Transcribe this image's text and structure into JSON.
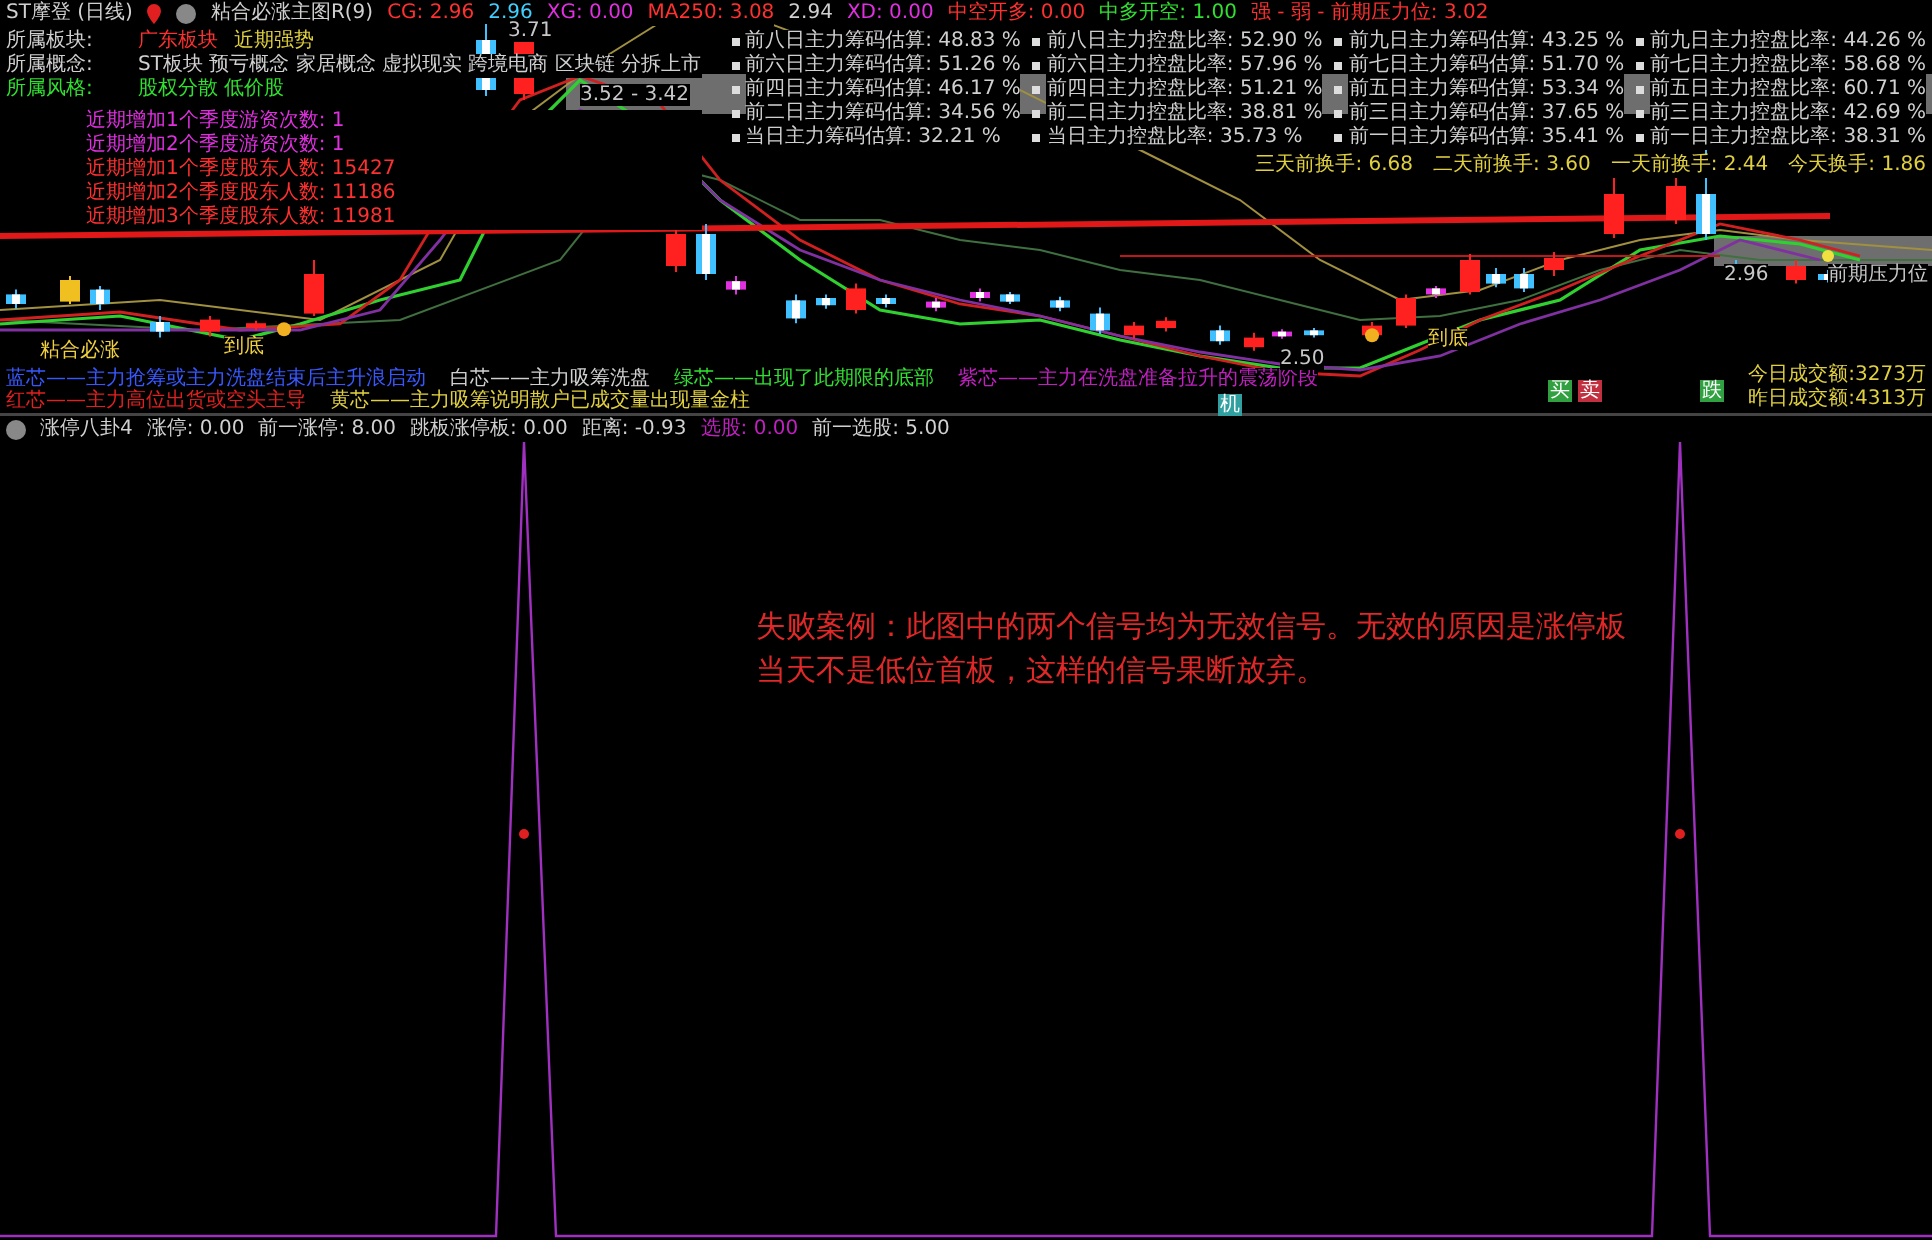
{
  "header": {
    "title": "ST摩登 (日线)",
    "indicator": "粘合必涨主图R(9)",
    "values": [
      {
        "text": "CG: 2.96",
        "color": "#ff3030"
      },
      {
        "text": "2.96",
        "color": "#40d0ff"
      },
      {
        "text": "XG: 0.00",
        "color": "#e030e0"
      },
      {
        "text": "MA250: 3.08",
        "color": "#ff3030"
      },
      {
        "text": "2.94",
        "color": "#d0d0d0"
      },
      {
        "text": "XD: 0.00",
        "color": "#e030e0"
      },
      {
        "text": "中空开多: 0.00",
        "color": "#ff3030"
      },
      {
        "text": "中多开空: 1.00",
        "color": "#30e030"
      },
      {
        "text": "强 - 弱 - 前期压力位: 3.02",
        "color": "#ff3030"
      }
    ]
  },
  "info_rows": [
    {
      "values": [
        {
          "text": "所属板块:",
          "color": "#d0d0d0"
        },
        {
          "text": "广东板块",
          "color": "#ff3030"
        },
        {
          "text": "近期强势",
          "color": "#e0d040"
        }
      ]
    },
    {
      "values": [
        {
          "text": "所属概念:",
          "color": "#d0d0d0"
        },
        {
          "text": "ST板块 预亏概念 家居概念 虚拟现实 跨境电商 区块链 分拆上市",
          "color": "#d0d0d0"
        }
      ]
    },
    {
      "values": [
        {
          "text": "所属风格:",
          "color": "#30e030"
        },
        {
          "text": "股权分散 低价股",
          "color": "#30e030"
        }
      ]
    }
  ],
  "holder_stats": [
    {
      "text": "近期增加1个季度游资次数: 1",
      "color": "#e030e0"
    },
    {
      "text": "近期增加2个季度游资次数: 1",
      "color": "#e030e0"
    },
    {
      "text": "近期增加1个季度股东人数: 15427",
      "color": "#ff3030"
    },
    {
      "text": "近期增加2个季度股东人数: 11186",
      "color": "#ff3030"
    },
    {
      "text": "近期增加3个季度股东人数: 11981",
      "color": "#ff3030"
    }
  ],
  "main_force_stats": [
    [
      "前八日主力筹码估算: 48.83 %",
      "前六日主力筹码估算: 51.26 %",
      "前四日主力筹码估算: 46.17 %",
      "前二日主力筹码估算: 34.56 %",
      "当日主力筹码估算: 32.21 %"
    ],
    [
      "前八日主力控盘比率: 52.90 %",
      "前六日主力控盘比率: 57.96 %",
      "前四日主力控盘比率: 51.21 %",
      "前二日主力控盘比率: 38.81 %",
      "当日主力控盘比率: 35.73 %"
    ],
    [
      "前九日主力筹码估算: 43.25 %",
      "前七日主力筹码估算: 51.70 %",
      "前五日主力筹码估算: 53.34 %",
      "前三日主力筹码估算: 37.65 %",
      "前一日主力筹码估算: 35.41 %"
    ],
    [
      "前九日主力控盘比率: 44.26 %",
      "前七日主力控盘比率: 58.68 %",
      "前五日主力控盘比率: 60.71 %",
      "前三日主力控盘比率: 42.69 %",
      "前一日主力控盘比率: 38.31 %"
    ]
  ],
  "turnover": [
    "三天前换手: 6.68",
    "二天前换手: 3.60",
    "一天前换手: 2.44",
    "今天换手: 1.86"
  ],
  "chart_labels": [
    {
      "text": "粘合必涨",
      "kind": "signal"
    },
    {
      "text": "到底",
      "kind": "signal"
    },
    {
      "text": "3.71",
      "kind": "price"
    },
    {
      "text": "3.52 - 3.42",
      "kind": "price"
    },
    {
      "text": "2.50",
      "kind": "price"
    },
    {
      "text": "到底",
      "kind": "signal"
    },
    {
      "text": "2.96",
      "kind": "price"
    },
    {
      "text": "前期压力位",
      "kind": "price"
    }
  ],
  "signal_badges": [
    {
      "text": "机",
      "color": "#30a0a0"
    },
    {
      "text": "买",
      "color": "#30a040"
    },
    {
      "text": "卖",
      "color": "#c03040"
    },
    {
      "text": "跌",
      "color": "#30a040"
    }
  ],
  "turnover_amount": [
    "今日成交额:3273万",
    "昨日成交额:4313万"
  ],
  "legend": [
    {
      "text": "蓝芯——主力抢筹或主力洗盘结束后主升浪启动",
      "color": "#3858ff"
    },
    {
      "text": "白芯——主力吸筹洗盘",
      "color": "#d0d0d0"
    },
    {
      "text": "绿芯——出现了此期限的底部",
      "color": "#30e030"
    },
    {
      "text": "紫芯——主力在洗盘准备拉升的震荡阶段",
      "color": "#c020c0"
    },
    {
      "text": "红芯——主力高位出货或空头主导",
      "color": "#e02020"
    },
    {
      "text": "黄芯——主力吸筹说明散户已成交量出现量金柱",
      "color": "#e0d040"
    }
  ],
  "indicator": {
    "name": "涨停八卦4",
    "values": [
      {
        "text": "涨停: 0.00",
        "color": "#d0d0d0"
      },
      {
        "text": "前一涨停: 8.00",
        "color": "#d0d0d0"
      },
      {
        "text": "跳板涨停板: 0.00",
        "color": "#d0d0d0"
      },
      {
        "text": "距离: -0.93",
        "color": "#d0d0d0"
      },
      {
        "text": "选股: 0.00",
        "color": "#c020c0"
      },
      {
        "text": "前一选股: 5.00",
        "color": "#d0d0d0"
      }
    ]
  },
  "annotation": {
    "lines": [
      "失败案例：此图中的两个信号均为无效信号。无效的原因是涨停板",
      "当天不是低位首板，这样的信号果断放弃。"
    ]
  }
}
